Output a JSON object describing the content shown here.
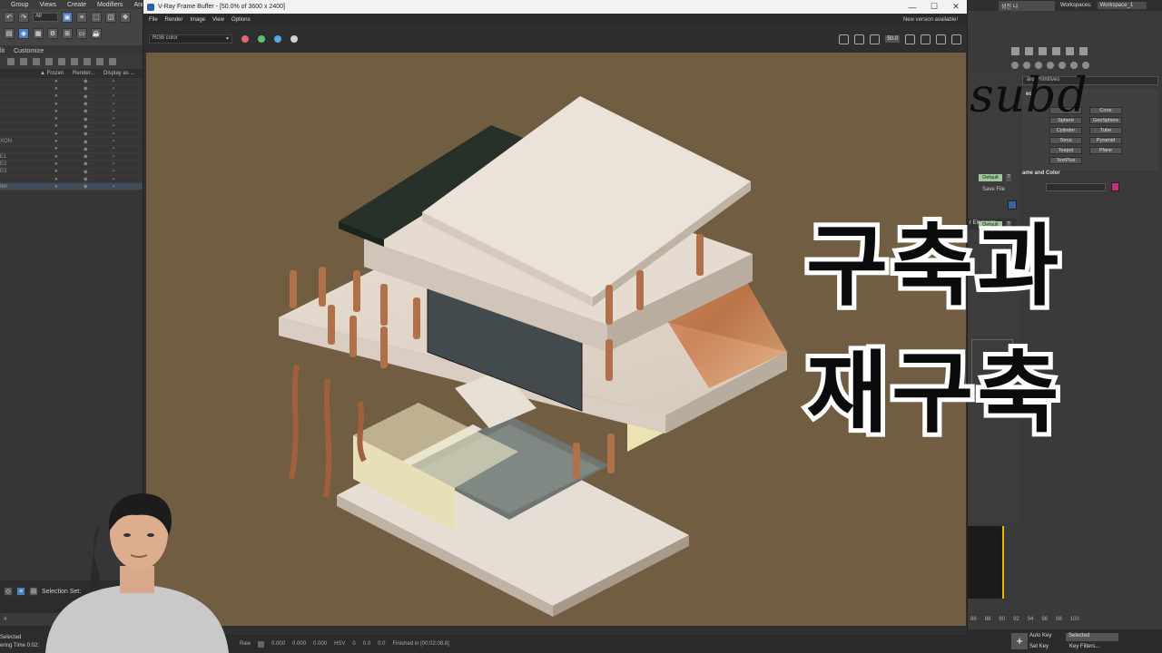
{
  "max": {
    "menu": [
      "Group",
      "Views",
      "Create",
      "Modifiers",
      "Ani"
    ],
    "filter_value": "All",
    "explorer_tabs": [
      "lit",
      "Customize"
    ],
    "explorer_columns": [
      "▲ Frozen",
      "Render...",
      "Display as ..."
    ],
    "explorer_rows": [
      "",
      "",
      "",
      "",
      "",
      "",
      "",
      "",
      "XON",
      "",
      "E1",
      "E2",
      "E3",
      "",
      "iter"
    ],
    "selection_set_label": "Selection Set:",
    "timeline_left_ticks": [
      "4",
      "",
      "",
      "10"
    ],
    "status_selected": "Selected",
    "status_render_time": "ering Time 0:02:"
  },
  "vfb": {
    "title": "V-Ray Frame Buffer - [50.0% of 3600 x 2400]",
    "menu": [
      "File",
      "Render",
      "Image",
      "View",
      "Options"
    ],
    "notice": "New version available!",
    "channel": "RGB color",
    "channel_dots": [
      "#e06868",
      "#5cc06b",
      "#5aa7e0",
      "#d0d0d0"
    ],
    "zoom_value": "50.0",
    "bottom": {
      "raw": "Raw",
      "v1": "0.000",
      "v2": "0.000",
      "v3": "0.000",
      "mode": "HSV",
      "v4": "0",
      "v5": "0.0",
      "v6": "0.0",
      "finished": "Finished in [00:02:08.8]"
    }
  },
  "cmd": {
    "user": "성진 나",
    "workspace_label": "Workspaces:",
    "workspace_value": "Workspace_1",
    "dropdown": "ard Primitives",
    "section_label": "ect",
    "primitives": [
      "Box",
      "Cone",
      "Sphere",
      "GeoSphere",
      "Cylinder",
      "Tube",
      "Torus",
      "Pyramid",
      "Teapot",
      "Plane",
      "TextPlus",
      ""
    ],
    "name_and_color": "ame and Color",
    "save_file": "Save File",
    "render_elements": "r Elements",
    "default_btn": "Default",
    "qmark": "?",
    "with_label": "with",
    "timeline_ticks": [
      "86",
      "88",
      "90",
      "92",
      "94",
      "96",
      "98",
      "100"
    ],
    "auto_key": "Auto Key",
    "set_key": "Set Key",
    "selected": "Selected",
    "key_filters": "Key Filters..."
  },
  "overlay": {
    "subd": "subd",
    "line1": "구축과",
    "line2": "재구축"
  },
  "colors": {
    "render_background": "#705d42",
    "accent_pink": "#c0307b"
  }
}
